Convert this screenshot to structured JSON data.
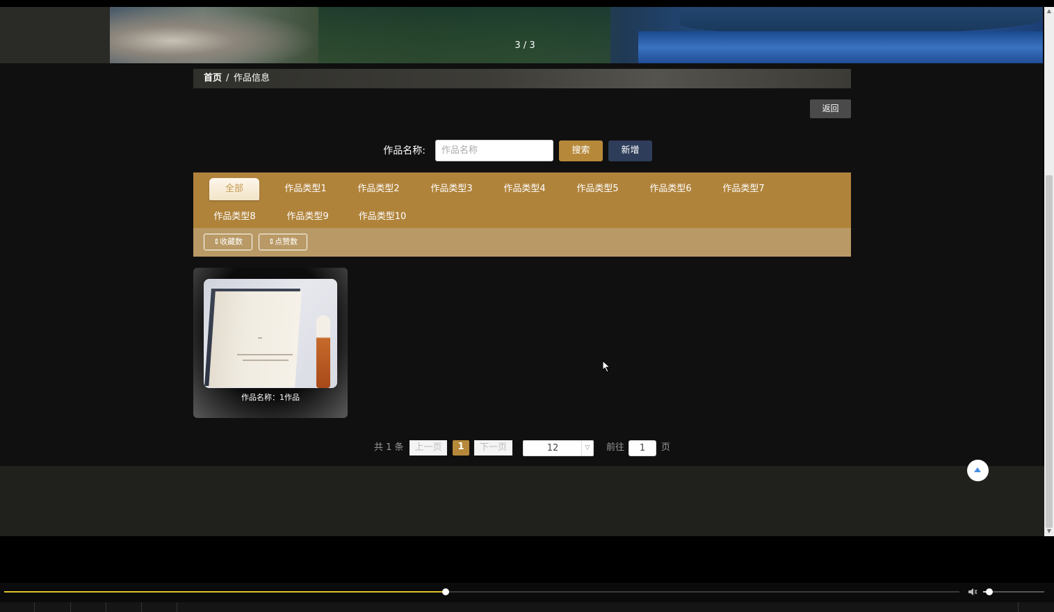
{
  "banner": {
    "slide_indicator": "3 / 3"
  },
  "breadcrumb": {
    "home": "首页",
    "separator": "/",
    "current": "作品信息"
  },
  "toolbar": {
    "back_label": "返回"
  },
  "search": {
    "label": "作品名称:",
    "placeholder": "作品名称",
    "value": "",
    "search_label": "搜索",
    "add_label": "新增"
  },
  "categories": [
    "全部",
    "作品类型1",
    "作品类型2",
    "作品类型3",
    "作品类型4",
    "作品类型5",
    "作品类型6",
    "作品类型7",
    "作品类型8",
    "作品类型9",
    "作品类型10"
  ],
  "active_category": "全部",
  "sort": {
    "favorites_label": "⇕收藏数",
    "likes_label": "⇕点赞数"
  },
  "works": [
    {
      "title": "作品名称：1作品"
    }
  ],
  "pagination": {
    "total": "共 1 条",
    "prev_label": "上一页",
    "current_page": "1",
    "next_label": "下一页",
    "page_size": "12",
    "goto_label": "前往",
    "goto_value": "1",
    "page_unit": "页"
  },
  "player": {
    "progress": 0.462,
    "volume": 0.1
  },
  "colors": {
    "accent": "#b6893a",
    "add_button": "#2e3d5a",
    "category_bg": "#b0833b",
    "sort_bg": "#b99a66",
    "page_bg": "#101010"
  },
  "icons": {
    "sort": "up-down-arrows-icon",
    "back_to_top": "triangle-up-icon",
    "volume": "speaker-icon"
  }
}
